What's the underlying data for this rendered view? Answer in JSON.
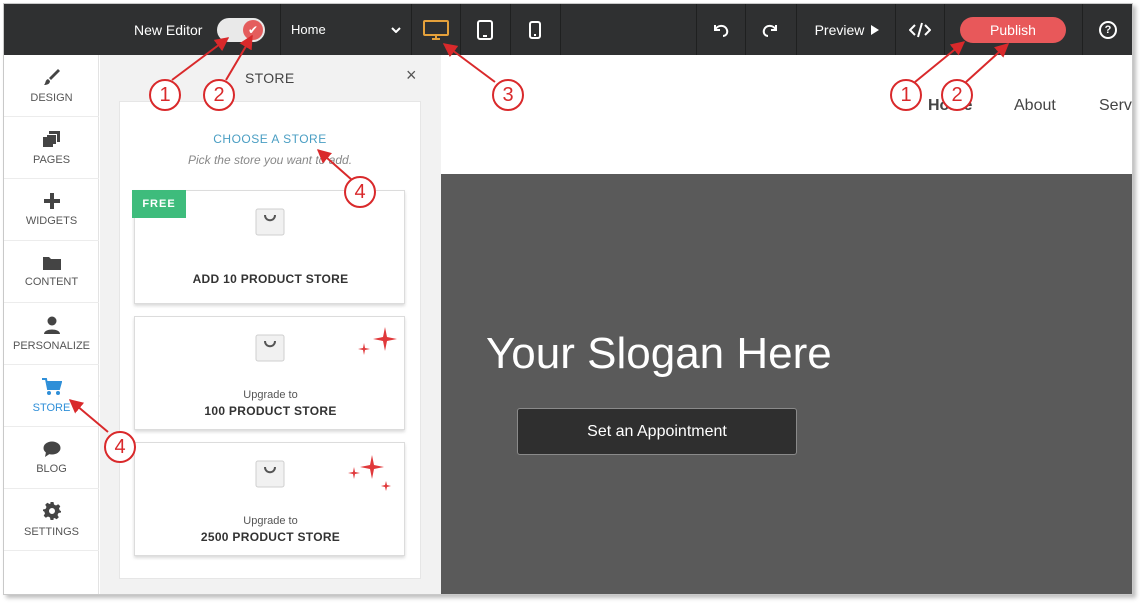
{
  "colors": {
    "accent": "#e8585a",
    "topbar": "#2f3031",
    "active_nav": "#2f8fd8",
    "free_badge": "#3ebc7c",
    "callout": "#d9292b"
  },
  "topbar": {
    "new_editor_label": "New Editor",
    "page_select_value": "Home",
    "preview_label": "Preview",
    "publish_label": "Publish",
    "help_glyph": "?"
  },
  "sidebar": {
    "items": [
      {
        "label": "DESIGN",
        "icon": "brush-icon"
      },
      {
        "label": "PAGES",
        "icon": "pages-icon"
      },
      {
        "label": "WIDGETS",
        "icon": "plus-icon"
      },
      {
        "label": "CONTENT",
        "icon": "folder-icon"
      },
      {
        "label": "PERSONALIZE",
        "icon": "person-icon"
      },
      {
        "label": "STORE",
        "icon": "cart-icon",
        "active": true
      },
      {
        "label": "BLOG",
        "icon": "chat-bubble-icon"
      },
      {
        "label": "SETTINGS",
        "icon": "gear-icon"
      }
    ]
  },
  "panel": {
    "title": "STORE",
    "close_glyph": "×",
    "choose_title": "CHOOSE A STORE",
    "choose_sub": "Pick the store you want to add.",
    "options": [
      {
        "badge": "FREE",
        "line1": "",
        "line2": "ADD 10 PRODUCT STORE"
      },
      {
        "line1": "Upgrade to",
        "line2": "100 PRODUCT STORE"
      },
      {
        "line1": "Upgrade to",
        "line2": "2500 PRODUCT STORE"
      }
    ]
  },
  "preview": {
    "nav": [
      "Home",
      "About",
      "Serv"
    ],
    "slogan": "Your Slogan Here",
    "button": "Set an Appointment"
  },
  "callouts": [
    "1",
    "2",
    "3",
    "1",
    "2",
    "4",
    "4"
  ]
}
